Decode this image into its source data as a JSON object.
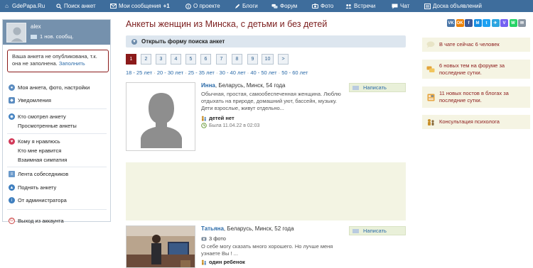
{
  "topbar": {
    "items": [
      {
        "label": "GdePapa.Ru",
        "icon": "home-icon"
      },
      {
        "label": "Поиск анкет",
        "icon": "search-icon"
      },
      {
        "label": "Мои сообщения",
        "badge": "+1",
        "icon": "messages-icon"
      },
      {
        "label": "О проекте",
        "icon": "info-icon"
      },
      {
        "label": "Блоги",
        "icon": "blogs-icon"
      },
      {
        "label": "Форум",
        "icon": "forum-icon"
      },
      {
        "label": "Фото",
        "icon": "camera-icon"
      },
      {
        "label": "Встречи",
        "icon": "meetings-icon"
      },
      {
        "label": "Чат",
        "icon": "chat-icon"
      },
      {
        "label": "Доска объявлений",
        "icon": "board-icon"
      }
    ]
  },
  "sidebar": {
    "user_name": "alex",
    "messages": "1 нов. сообщ.",
    "notice_text": "Ваша анкета не опубликована, т.к. она не заполнена.",
    "notice_link": "Заполнить",
    "menu": [
      {
        "label": "Моя анкета, фото, настройки",
        "icon": "user-icon"
      },
      {
        "label": "Уведомления",
        "icon": "bell-icon"
      },
      {
        "label": "Кто смотрел анкету",
        "icon": "eye-icon"
      },
      {
        "label": "Просмотренные анкеты"
      },
      {
        "label": "Кому я нравлюсь",
        "icon": "heart-icon"
      },
      {
        "label": "Кто мне нравится"
      },
      {
        "label": "Взаимная симпатия"
      },
      {
        "label": "Лента собеседников",
        "icon": "feed-icon"
      },
      {
        "label": "Поднять анкету",
        "icon": "arrow-up-icon"
      },
      {
        "label": "От администратора",
        "icon": "info-icon"
      },
      {
        "label": "Выход из аккаунта",
        "icon": "logout-icon"
      }
    ]
  },
  "main": {
    "title": "Анкеты женщин из Минска, с детьми и без детей",
    "search_toggle": "Открыть форму поиска анкет",
    "pages": [
      "1",
      "2",
      "3",
      "4",
      "5",
      "6",
      "7",
      "8",
      "9",
      "10",
      ">"
    ],
    "active_page": "1",
    "age_ranges": [
      "18 - 25 лет",
      "20 - 30 лет",
      "25 - 35 лет",
      "30 - 40 лет",
      "40 - 50 лет",
      "50 - 60 лет"
    ],
    "write_label": "Написать",
    "profiles": [
      {
        "name": "Инна",
        "details": ", Беларусь, Минск, 54 года",
        "text": "Обычная, простая, самообеспеченная женщина. Люблю отдыхать на природе, домашний уют, бассейн, музыку. Дети взрослые, живут отдельно...",
        "kids": "детей нет",
        "seen": "Была 11.04.22 в 02:03"
      },
      {
        "name": "Татьяна",
        "details": ", Беларусь, Минск, 52 года",
        "photos": "3 фото",
        "text": "О себе могу сказать много хорошего. Но лучше меня узнаете Вы ! ...",
        "kids": "один ребенок"
      }
    ]
  },
  "right": {
    "share_buttons": [
      {
        "label": "VK",
        "color": "#4a76a8",
        "icon": "vk-icon"
      },
      {
        "label": "OK",
        "color": "#ee8208",
        "icon": "ok-icon"
      },
      {
        "label": "f",
        "color": "#3b5998",
        "icon": "facebook-icon"
      },
      {
        "label": "M",
        "color": "#168de2",
        "icon": "mailru-icon"
      },
      {
        "label": "t",
        "color": "#1da1f2",
        "icon": "twitter-icon"
      },
      {
        "label": "✈",
        "color": "#2ca5e0",
        "icon": "telegram-icon"
      },
      {
        "label": "V",
        "color": "#7360f2",
        "icon": "viber-icon"
      },
      {
        "label": "W",
        "color": "#25d366",
        "icon": "whatsapp-icon"
      },
      {
        "label": "✉",
        "color": "#8a96a3",
        "icon": "email-icon"
      }
    ],
    "boxes": [
      {
        "text": "В чате сейчас 6 человек",
        "icon": "chat-bubble-icon"
      },
      {
        "text": "6 новых тем на форуме за последние сутки.",
        "icon": "forum-topics-icon"
      },
      {
        "text": "11 новых постов в блогах за последние сутки.",
        "icon": "blog-posts-icon"
      },
      {
        "text": "Консультация психолога",
        "icon": "psychologist-icon"
      }
    ]
  }
}
